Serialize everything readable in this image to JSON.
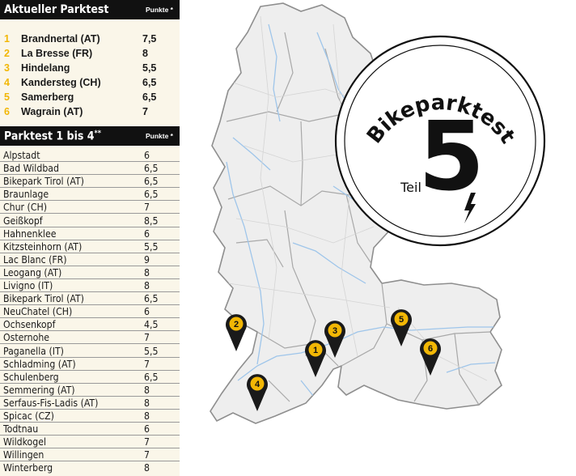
{
  "current_test": {
    "title": "Aktueller Parktest",
    "points_header": "Punkte *",
    "items": [
      {
        "num": "1",
        "name": "Brandnertal (AT)",
        "score": "7,5"
      },
      {
        "num": "2",
        "name": "La Bresse (FR)",
        "score": "8"
      },
      {
        "num": "3",
        "name": "Hindelang",
        "score": "5,5"
      },
      {
        "num": "4",
        "name": "Kandersteg (CH)",
        "score": "6,5"
      },
      {
        "num": "5",
        "name": "Samerberg",
        "score": "6,5"
      },
      {
        "num": "6",
        "name": "Wagrain (AT)",
        "score": "7"
      }
    ]
  },
  "previous_tests": {
    "title": "Parktest 1 bis 4",
    "title_sup": "**",
    "points_header": "Punkte *",
    "items": [
      {
        "name": "Alpstadt",
        "score": "6"
      },
      {
        "name": "Bad Wildbad",
        "score": "6,5"
      },
      {
        "name": "Bikepark Tirol (AT)",
        "score": "6,5"
      },
      {
        "name": "Braunlage",
        "score": "6,5"
      },
      {
        "name": "Chur (CH)",
        "score": "7"
      },
      {
        "name": "Geißkopf",
        "score": "8,5"
      },
      {
        "name": "Hahnenklee",
        "score": "6"
      },
      {
        "name": "Kitzsteinhorn (AT)",
        "score": "5,5"
      },
      {
        "name": "Lac Blanc (FR)",
        "score": "9"
      },
      {
        "name": "Leogang (AT)",
        "score": "8"
      },
      {
        "name": "Livigno (IT)",
        "score": "8"
      },
      {
        "name": "Bikepark Tirol (AT)",
        "score": "6,5"
      },
      {
        "name": "NeuChatel (CH)",
        "score": "6"
      },
      {
        "name": "Ochsenkopf",
        "score": "4,5"
      },
      {
        "name": "Osternohe",
        "score": "7"
      },
      {
        "name": "Paganella (IT)",
        "score": "5,5"
      },
      {
        "name": "Schladming (AT)",
        "score": "7"
      },
      {
        "name": "Schulenberg",
        "score": "6,5"
      },
      {
        "name": "Semmering (AT)",
        "score": "8"
      },
      {
        "name": "Serfaus-Fis-Ladis (AT)",
        "score": "8"
      },
      {
        "name": "Spicac (CZ)",
        "score": "8"
      },
      {
        "name": "Todtnau",
        "score": "6"
      },
      {
        "name": "Wildkogel",
        "score": "7"
      },
      {
        "name": "Willingen",
        "score": "7"
      },
      {
        "name": "Winterberg",
        "score": "8"
      }
    ]
  },
  "badge": {
    "title": "Bikeparktest",
    "number": "5",
    "part": "Teil"
  },
  "map": {
    "markers": [
      "1",
      "2",
      "3",
      "4",
      "5",
      "6"
    ],
    "colors": {
      "land": "#eeeeee",
      "border": "#9a9a9a",
      "river": "#9ec5ea",
      "marker": "#1a1a1a",
      "marker_ring": "#f2b705",
      "accent": "#f2b705"
    }
  }
}
